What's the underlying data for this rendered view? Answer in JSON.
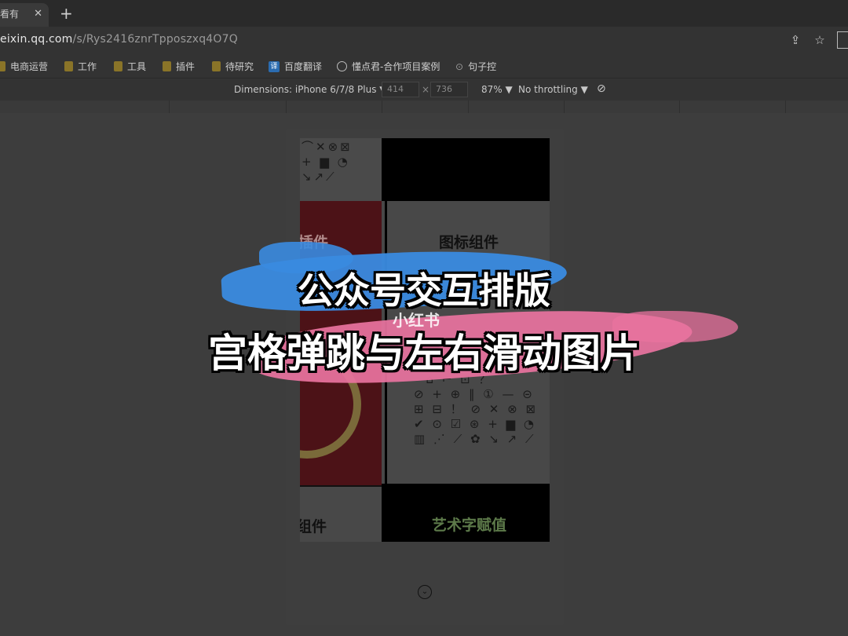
{
  "tab": {
    "title": "看有",
    "close": "✕"
  },
  "new_tab": "+",
  "address": {
    "host": "eixin.qq.com",
    "path": "/s/Rys2416znrTpposzxq4O7Q"
  },
  "bookmarks": [
    {
      "label": "电商运营",
      "icon": "folder-icon"
    },
    {
      "label": "工作",
      "icon": "folder-icon"
    },
    {
      "label": "工具",
      "icon": "folder-icon"
    },
    {
      "label": "插件",
      "icon": "folder-icon"
    },
    {
      "label": "待研究",
      "icon": "folder-icon"
    },
    {
      "label": "百度翻译",
      "icon": "translate-icon"
    },
    {
      "label": "懂点君-合作项目案例",
      "icon": "globe-icon"
    },
    {
      "label": "句子控",
      "icon": "quote-icon"
    }
  ],
  "devtools": {
    "dimensions_label": "Dimensions: iPhone 6/7/8 Plus ▼",
    "width": "414",
    "times": "×",
    "height": "736",
    "zoom": "87% ▼",
    "throttling": "No throttling ▼"
  },
  "grid": {
    "mid_left_title": "插件",
    "mid_right_title": "图标组件",
    "bottom_left_title": "组件",
    "bottom_right_title": "艺术字赋值"
  },
  "overlay": {
    "line1": "公众号交互排版",
    "line2": "宫格弹跳与左右滑动图片",
    "watermark": "小红书"
  },
  "colors": {
    "brush_blue": "#3a8be0",
    "brush_pink": "#e9739f",
    "art_text": "#5d7a4a"
  }
}
